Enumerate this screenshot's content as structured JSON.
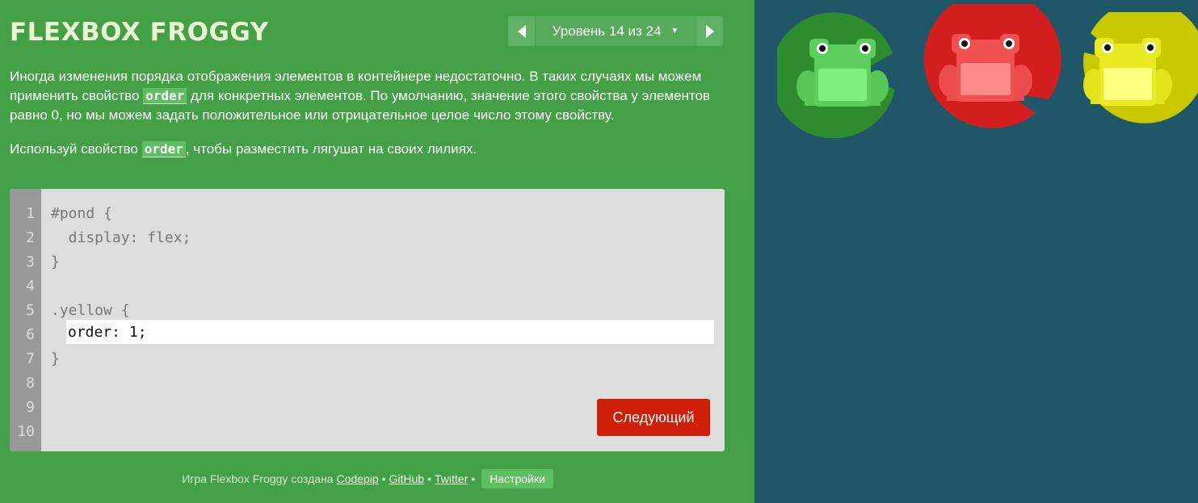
{
  "header": {
    "logo": "FLEXBOX FROGGY",
    "level_label": "Уровень 14 из 24",
    "prev_icon": "chevron-left-icon",
    "next_icon": "chevron-right-icon",
    "dropdown_icon": "caret-down-icon"
  },
  "instructions": {
    "p1_before": "Иногда изменения порядка отображения элементов в контейнере недостаточно. В таких случаях мы можем применить свойство ",
    "p1_code": "order",
    "p1_after": " для конкретных элементов. По умолчанию, значение этого свойства у элементов равно 0, но мы можем задать положительное или отрицательное целое число этому свойству.",
    "p2_before": "Используй свойство ",
    "p2_code": "order",
    "p2_after": ", чтобы разместить лягушат на своих лилиях."
  },
  "editor": {
    "line_numbers": [
      "1",
      "2",
      "3",
      "4",
      "5",
      "6",
      "7",
      "8",
      "9",
      "10"
    ],
    "lines": [
      "#pond {",
      "  display: flex;",
      "}",
      "",
      ".yellow {",
      "",
      "}",
      "",
      "",
      ""
    ],
    "input_value": "order: 1;",
    "next_button": "Следующий"
  },
  "footer": {
    "text_prefix": "Игра Flexbox Froggy создана ",
    "codepip": "Codepip",
    "github": "GitHub",
    "twitter": "Twitter",
    "separator": "•",
    "settings": "Настройки"
  },
  "pond": {
    "frogs": [
      {
        "color": "green",
        "pad_color": "#2e8b2e",
        "body_color": "#5cce5c"
      },
      {
        "color": "red",
        "pad_color": "#d21e1e",
        "body_color": "#f05050"
      },
      {
        "color": "yellow",
        "pad_color": "#c9c900",
        "body_color": "#eaea22"
      }
    ]
  },
  "colors": {
    "sidebar_bg": "#43a047",
    "pond_bg": "#1f5768",
    "next_button": "#d01f08"
  }
}
